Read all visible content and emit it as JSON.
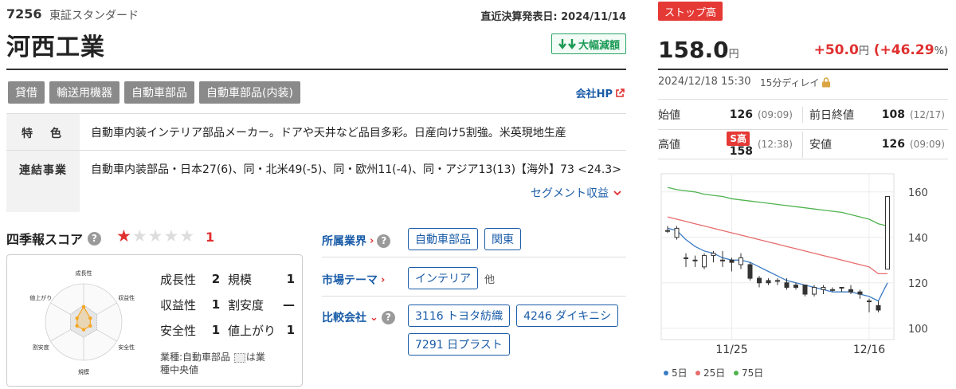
{
  "header": {
    "code": "7256",
    "market": "東証スタンダード",
    "kessan": "直近決算発表日: 2024/11/14",
    "name": "河西工業",
    "badge": "大幅減額",
    "badge_color": "#1b9a55"
  },
  "tags": [
    "貸借",
    "輸送用機器",
    "自動車部品",
    "自動車部品(内装)"
  ],
  "company_hp": "会社HP",
  "info": {
    "tokushoku_label": "特　色",
    "tokushoku": "自動車内装インテリア部品メーカー。ドアや天井など品目多彩。日産向け5割強。米英現地生産",
    "renketsu_label": "連結事業",
    "renketsu": "自動車内装部品・日本27(6)、同・北米49(-5)、同・欧州11(-4)、同・アジア13(13)【海外】73 <24.3>",
    "segment_link": "セグメント収益"
  },
  "score": {
    "title": "四季報スコア",
    "stars_on": 1,
    "stars_total": 5,
    "value": "1",
    "axes": [
      "成長性",
      "収益性",
      "安全性",
      "規模",
      "割安度",
      "値上がり"
    ],
    "rows": [
      {
        "k1": "成長性",
        "v1": "2",
        "k2": "規模",
        "v2": "1"
      },
      {
        "k1": "収益性",
        "v1": "1",
        "k2": "割安度",
        "v2": "—"
      },
      {
        "k1": "安全性",
        "v1": "1",
        "k2": "値上がり",
        "v2": "1"
      }
    ],
    "note_a": "業種:自動車部品",
    "note_b": "は業",
    "note_c": "種中央値",
    "radar_values": [
      2,
      1,
      1,
      1,
      1,
      1
    ],
    "radar_max": 5
  },
  "relations": {
    "industry_label": "所属業界",
    "industry_chips": [
      "自動車部品",
      "関東"
    ],
    "theme_label": "市場テーマ",
    "theme_chips": [
      "インテリア"
    ],
    "theme_other": "他",
    "peer_label": "比較会社",
    "peer_chips": [
      "3116 トヨタ紡織",
      "4246 ダイキニシ",
      "7291 日プラスト"
    ]
  },
  "quote": {
    "stop": "ストップ高",
    "price": "158.0",
    "price_unit": "円",
    "change": "+50.0",
    "change_unit": "円",
    "change_pct_open": " (",
    "change_pct": "+46.29",
    "change_pct_close": "%)",
    "timestamp": "2024/12/18 15:30",
    "delay": "15分ディレイ",
    "open_label": "始値",
    "open": "126",
    "open_time": "(09:09)",
    "prev_label": "前日終値",
    "prev": "108",
    "prev_time": "(12/17)",
    "high_label": "高値",
    "high_pill": "S高",
    "high": "158",
    "high_time": "(12:38)",
    "low_label": "安値",
    "low": "126",
    "low_time": "(09:09)",
    "up_color": "#e03030"
  },
  "chart_data": {
    "type": "candlestick",
    "ylim": [
      95,
      168
    ],
    "yticks": [
      100,
      120,
      140,
      160
    ],
    "xticks": [
      {
        "label": "11/25",
        "index": 7
      },
      {
        "label": "12/16",
        "index": 22
      }
    ],
    "candles": [
      {
        "o": 143,
        "h": 145,
        "l": 142,
        "c": 143
      },
      {
        "o": 140,
        "h": 145,
        "l": 139,
        "c": 144
      },
      {
        "o": 131,
        "h": 133,
        "l": 127,
        "c": 131
      },
      {
        "o": 130,
        "h": 132,
        "l": 127,
        "c": 130
      },
      {
        "o": 127,
        "h": 133,
        "l": 126,
        "c": 132
      },
      {
        "o": 132,
        "h": 134,
        "l": 129,
        "c": 133
      },
      {
        "o": 130,
        "h": 134,
        "l": 127,
        "c": 130
      },
      {
        "o": 130,
        "h": 131,
        "l": 125,
        "c": 129
      },
      {
        "o": 128,
        "h": 133,
        "l": 126,
        "c": 131
      },
      {
        "o": 128,
        "h": 129,
        "l": 121,
        "c": 122
      },
      {
        "o": 122,
        "h": 123,
        "l": 118,
        "c": 120
      },
      {
        "o": 121,
        "h": 122,
        "l": 119,
        "c": 120
      },
      {
        "o": 121,
        "h": 122,
        "l": 119,
        "c": 121
      },
      {
        "o": 120,
        "h": 122,
        "l": 117,
        "c": 118
      },
      {
        "o": 119,
        "h": 120,
        "l": 117,
        "c": 118
      },
      {
        "o": 119,
        "h": 119,
        "l": 114,
        "c": 115
      },
      {
        "o": 115,
        "h": 119,
        "l": 114,
        "c": 118
      },
      {
        "o": 117,
        "h": 119,
        "l": 115,
        "c": 118
      },
      {
        "o": 117,
        "h": 118,
        "l": 116,
        "c": 117
      },
      {
        "o": 118,
        "h": 118,
        "l": 116,
        "c": 118
      },
      {
        "o": 117,
        "h": 119,
        "l": 115,
        "c": 116
      },
      {
        "o": 116,
        "h": 117,
        "l": 113,
        "c": 115
      },
      {
        "o": 112,
        "h": 113,
        "l": 107,
        "c": 112
      },
      {
        "o": 110,
        "h": 112,
        "l": 107,
        "c": 108
      },
      {
        "o": 126,
        "h": 158,
        "l": 126,
        "c": 158
      }
    ],
    "series": [
      {
        "name": "5日",
        "color": "#3b7bc4",
        "values": [
          144,
          143,
          139,
          136,
          134,
          133,
          131,
          130,
          130,
          129,
          127,
          125,
          123,
          121,
          120,
          119,
          118,
          117,
          116,
          116,
          116,
          115,
          114,
          112,
          120
        ]
      },
      {
        "name": "25日",
        "color": "#e86b6b",
        "values": [
          149,
          148,
          147,
          146,
          145,
          144,
          143,
          142,
          141,
          140,
          139,
          138,
          137,
          136,
          135,
          134,
          133,
          132,
          131,
          130,
          129,
          128,
          127,
          124,
          124
        ]
      },
      {
        "name": "75日",
        "color": "#4fb34f",
        "values": [
          162,
          161,
          160.5,
          160,
          159,
          158.5,
          158,
          157,
          156.5,
          156,
          155.5,
          155,
          154.5,
          154,
          153.5,
          153,
          152.5,
          152,
          151.5,
          151,
          150,
          149,
          148,
          146,
          145
        ]
      }
    ],
    "legend": [
      "5日",
      "25日",
      "75日"
    ]
  }
}
